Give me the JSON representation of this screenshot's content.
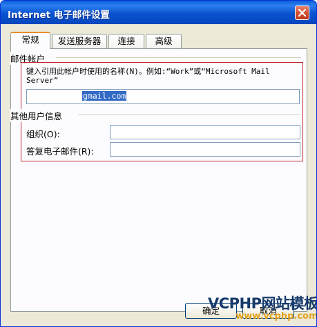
{
  "window": {
    "title": "Internet 电子邮件设置"
  },
  "tabs": [
    {
      "label": "常规",
      "active": true
    },
    {
      "label": "发送服务器",
      "active": false
    },
    {
      "label": "连接",
      "active": false
    },
    {
      "label": "高级",
      "active": false
    }
  ],
  "account": {
    "group_label": "邮件帐户",
    "instruction": "键入引用此帐户时使用的名称(N)。例如:“Work”或“Microsoft Mail Server”",
    "name_value": "gmail.com"
  },
  "other_info": {
    "group_label": "其他用户信息",
    "org_label": "组织(O):",
    "org_value": "",
    "reply_label": "答复电子邮件(R):",
    "reply_value": ""
  },
  "buttons": {
    "ok": "确定",
    "cancel": "取消"
  },
  "watermark": {
    "line1": "VCPHP网站模板",
    "line2": "www.vcphp.com"
  },
  "colors": {
    "title_bar": "#0a53d0",
    "highlight": "#c0262c",
    "selection": "#316ac5"
  }
}
